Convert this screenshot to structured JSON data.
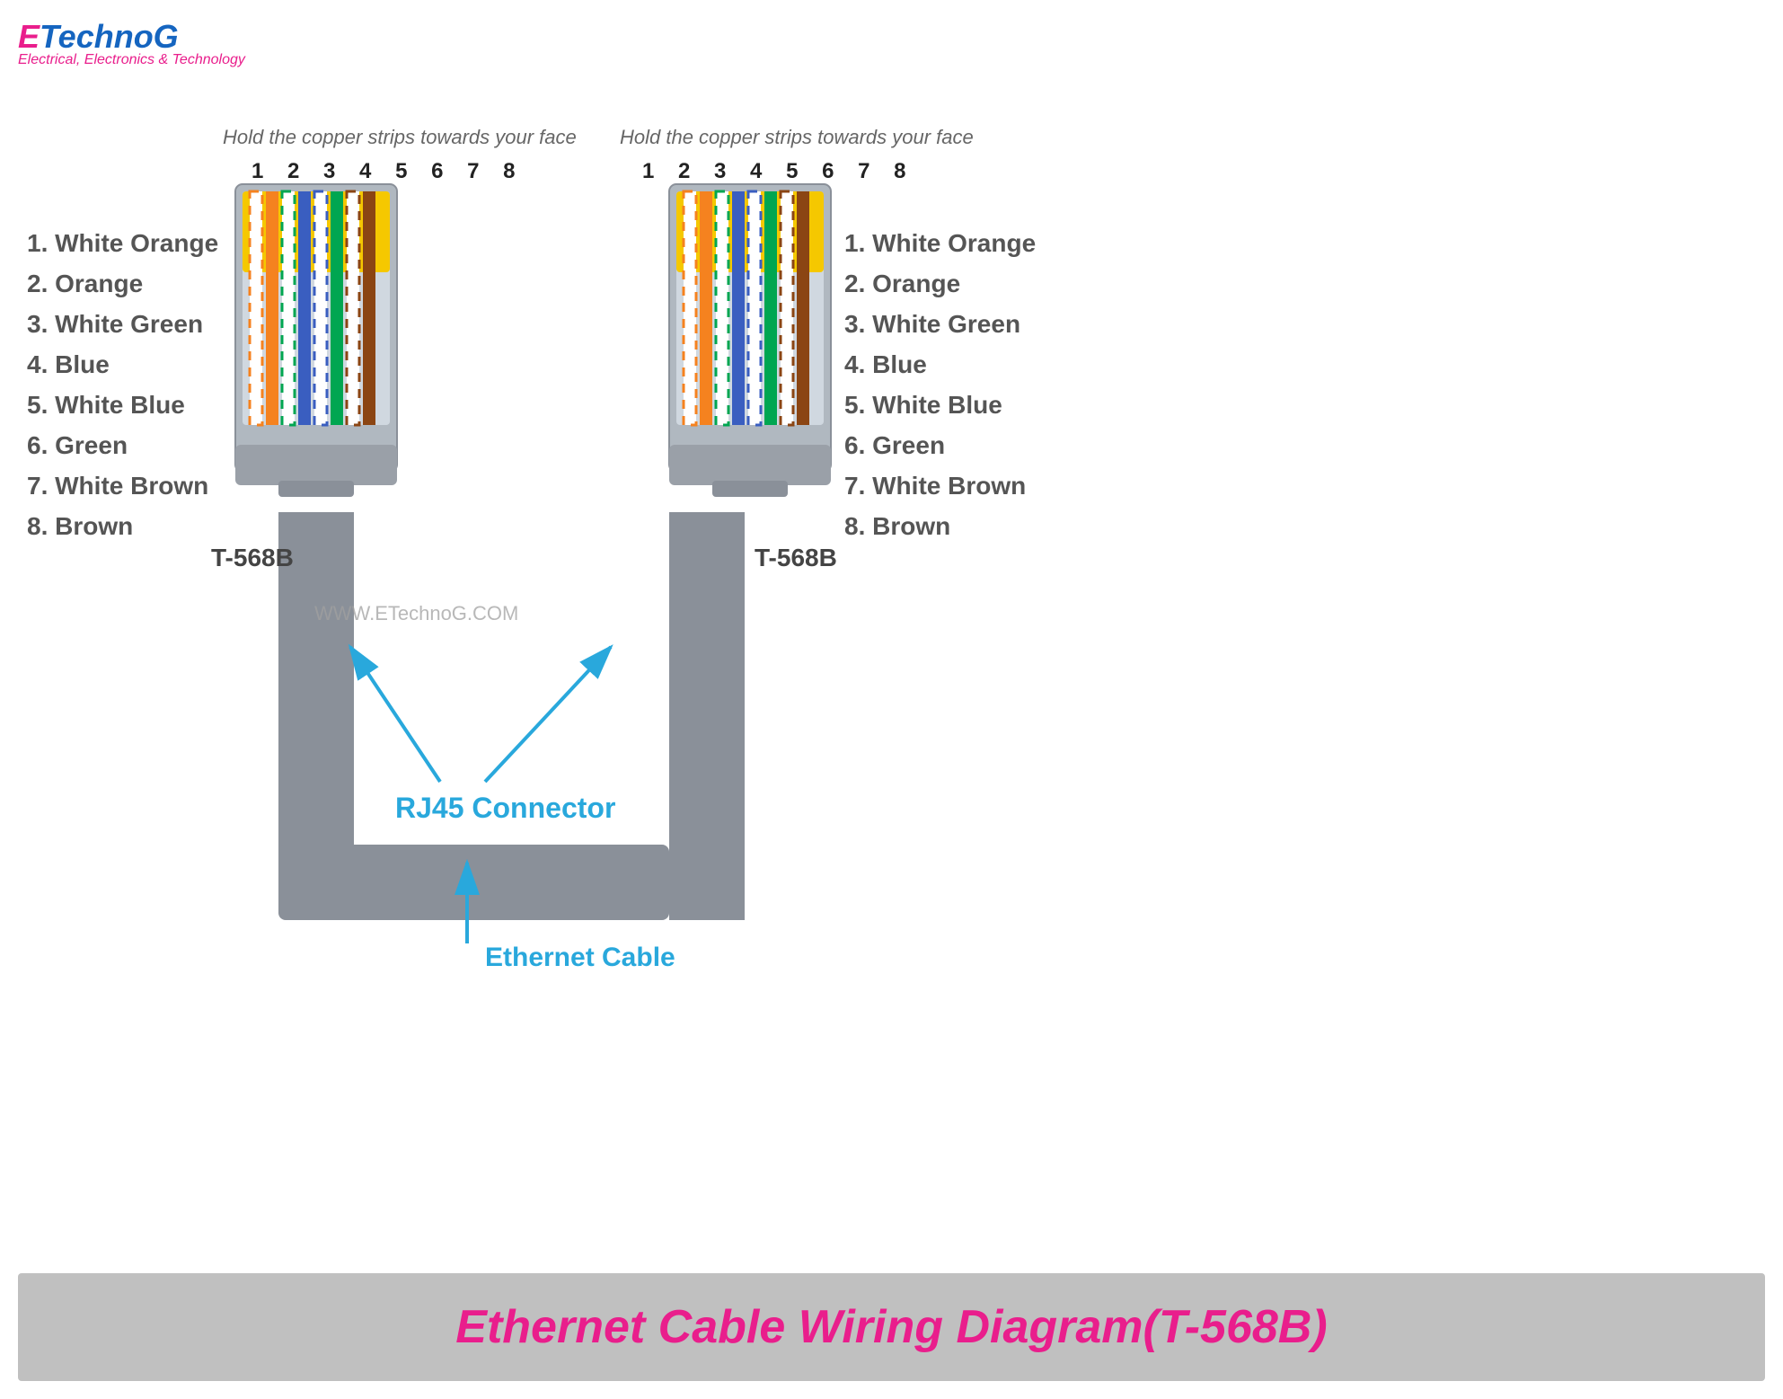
{
  "logo": {
    "e": "E",
    "technog": "TechnoG",
    "subtitle": "Electrical, Electronics & Technology"
  },
  "instructions": {
    "left": "Hold the copper strips towards your face",
    "right": "Hold the copper strips towards your face"
  },
  "pin_numbers": "1 2 3 4 5 6 7 8",
  "wire_labels": [
    "1. White Orange",
    "2. Orange",
    "3. White Green",
    "4. Blue",
    "5. White Blue",
    "6. Green",
    "7. White Brown",
    "8. Brown"
  ],
  "connector_label": "T-568B",
  "rj45_label": "RJ45 Connector",
  "ethernet_label": "Ethernet Cable",
  "watermark": "WWW.ETechnoG.COM",
  "banner_text": "Ethernet Cable Wiring Diagram(T-568B)"
}
